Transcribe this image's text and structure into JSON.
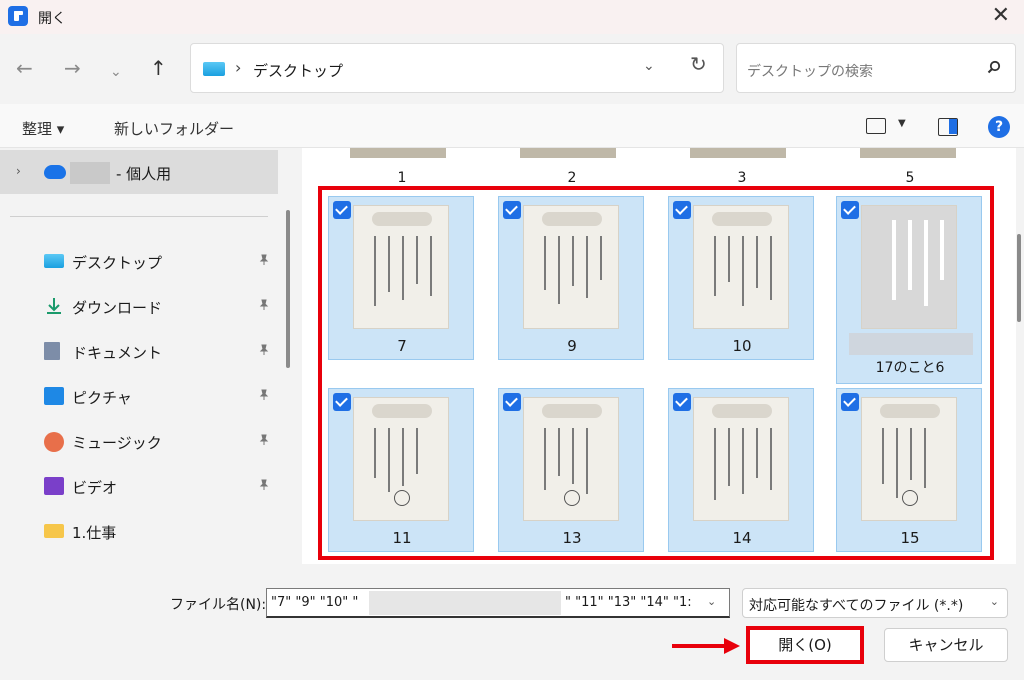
{
  "window": {
    "title": "開く",
    "close_glyph": "✕"
  },
  "nav": {
    "back": "←",
    "forward": "→",
    "recent": "⌄",
    "up": "↑",
    "address_chevron": "›",
    "address_text": "デスクトップ",
    "address_dropdown": "⌄",
    "refresh": "↻",
    "search_placeholder": "デスクトップの検索"
  },
  "commands": {
    "organize": "整理 ▾",
    "new_folder": "新しいフォルダー",
    "view_dropdown": "▼",
    "help": "?"
  },
  "sidebar": {
    "onedrive_chevron": "›",
    "onedrive_label": "- 個人用",
    "items": [
      {
        "label": "デスクトップ",
        "icon": "desktop-icon",
        "pinned": true
      },
      {
        "label": "ダウンロード",
        "icon": "download-icon",
        "pinned": true
      },
      {
        "label": "ドキュメント",
        "icon": "document-icon",
        "pinned": true
      },
      {
        "label": "ピクチャ",
        "icon": "pictures-icon",
        "pinned": true
      },
      {
        "label": "ミュージック",
        "icon": "music-icon",
        "pinned": true
      },
      {
        "label": "ビデオ",
        "icon": "video-icon",
        "pinned": true
      },
      {
        "label": "1.仕事",
        "icon": "folder-icon",
        "pinned": false
      }
    ]
  },
  "files": {
    "top_row": [
      "1",
      "2",
      "3",
      "5"
    ],
    "tiles": [
      {
        "name": "7",
        "selected": true
      },
      {
        "name": "9",
        "selected": true
      },
      {
        "name": "10",
        "selected": true
      },
      {
        "name": "17のこと6",
        "selected": true
      },
      {
        "name": "11",
        "selected": true
      },
      {
        "name": "13",
        "selected": true
      },
      {
        "name": "14",
        "selected": true
      },
      {
        "name": "15",
        "selected": true
      }
    ]
  },
  "bottom": {
    "filename_label": "ファイル名(N):",
    "filename_part1": "\"7\" \"9\" \"10\" \"",
    "filename_part2": "\" \"11\" \"13\" \"14\" \"1:",
    "filename_dropdown": "⌄",
    "filetype": "対応可能なすべてのファイル (*.*)",
    "filetype_dropdown": "⌄",
    "open_button": "開く(O)",
    "cancel_button": "キャンセル"
  },
  "colors": {
    "accent": "#1f6fe5",
    "highlight": "#e8000b",
    "selection": "#cce4f7"
  }
}
